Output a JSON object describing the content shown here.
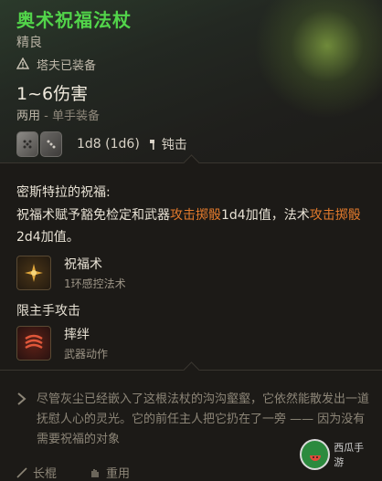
{
  "item": {
    "name": "奥术祝福法杖",
    "rarity": "精良",
    "equipped_by": "塔夫已装备",
    "damage": "1~6伤害",
    "hands": "两用",
    "hands_sub": "- 单手装备",
    "dice_formula": "1d8 (1d6)",
    "proficiency": "钝击",
    "die_icons": [
      "d-icon",
      "d-icon"
    ]
  },
  "blessing": {
    "title": "密斯特拉的祝福:",
    "text_a": "祝福术赋予豁免检定和武器",
    "text_hl1": "攻击掷骰",
    "text_b": "1d4加值，法术",
    "text_hl2": "攻击掷骰",
    "text_c": "2d4加值。"
  },
  "spells": [
    {
      "name": "祝福术",
      "sub": "1环感控法术",
      "icon": "bless-icon"
    },
    {
      "name": "摔绊",
      "sub": "武器动作",
      "icon": "topple-icon"
    }
  ],
  "mainhand_label": "限主手攻击",
  "flavor": "尽管灰尘已经嵌入了这根法杖的沟沟壑壑，它依然能散发出一道抚慰人心的灵光。它的前任主人把它扔在了一旁 —— 因为没有需要祝福的对象",
  "bottom": {
    "left": "长棍",
    "right": "重用"
  },
  "watermark": "西瓜手游",
  "colors": {
    "name": "#52d44a",
    "highlight": "#e27a2c"
  }
}
